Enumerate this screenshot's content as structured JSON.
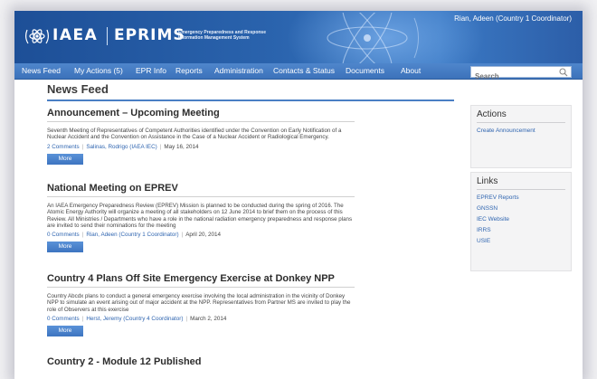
{
  "header": {
    "org": "IAEA",
    "app": "EPRIMS",
    "tagline_1": "Emergency Preparedness and Response",
    "tagline_2": "Information Management System",
    "user": "Rian, Adeen (Country 1 Coordinator)"
  },
  "nav": {
    "items": [
      "News Feed",
      "My Actions (5)",
      "EPR Info",
      "Reports",
      "Administration",
      "Contacts & Status",
      "Documents",
      "About"
    ],
    "search_placeholder": "Search"
  },
  "main": {
    "title": "News Feed",
    "more_label": "More",
    "posts": [
      {
        "title": "Announcement – Upcoming Meeting",
        "body": "Seventh Meeting of Representatives of Competent Authorities identified under the Convention on Early Notification of a Nuclear Accident and the Convention on Assistance in the Case of a Nuclear Accident or Radiological Emergency.",
        "comments": "2 Comments",
        "author": "Salinas, Rodrigo (IAEA IEC)",
        "date": "May 16, 2014"
      },
      {
        "title": "National Meeting on EPREV",
        "body": "An IAEA Emergency Preparedness Review (EPREV) Mission is planned to be conducted during the spring of 2016. The Atomic Energy Authority will organize a meeting of all stakeholders on 12 June 2014 to brief them on the process of this Review. All Ministries / Departments who have a role in the national radiation emergency preparedness and response plans are invited to send their nominations for the meeting",
        "comments": "0 Comments",
        "author": "Rian, Adeen (Country 1 Coordinator)",
        "date": "April 20, 2014"
      },
      {
        "title": "Country 4 Plans Off Site Emergency Exercise at Donkey NPP",
        "body": "Country Abcdx plans to conduct a general emergency exercise involving the local administration in the vicinity of Donkey NPP to simulate an event arising out of major accident at the NPP. Representatives from Partner MS are invited to play the role of Observers at this exercise",
        "comments": "0 Comments",
        "author": "Herst, Jeremy (Country 4 Coordinator)",
        "date": "March 2, 2014"
      },
      {
        "title": "Country 2 - Module 12 Published"
      }
    ]
  },
  "sidebar": {
    "actions_title": "Actions",
    "actions": [
      "Create Announcement"
    ],
    "links_title": "Links",
    "links": [
      "EPREV Reports",
      "GNSSN",
      "IEC Website",
      "IRRS",
      "USIE"
    ]
  },
  "colors": {
    "banner": "#2a63ad",
    "navbar": "#4f86cc",
    "link": "#2f65b0",
    "button": "#3d74c0"
  },
  "icons": [
    "iaea-emblem-icon",
    "atom-graphic-icon",
    "search-icon"
  ]
}
